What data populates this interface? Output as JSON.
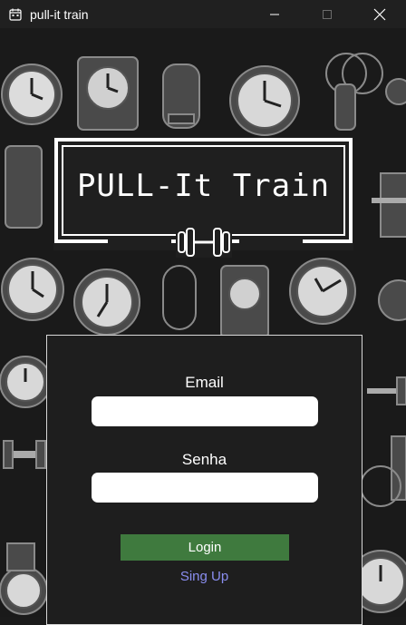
{
  "window": {
    "title": "pull-it train",
    "icons": {
      "app": "calendar-icon",
      "minimize": "minimize-icon",
      "maximize": "maximize-icon",
      "close": "close-icon"
    }
  },
  "logo": {
    "text": "PULL-It Train",
    "icon": "dumbbell-icon"
  },
  "background": {
    "pattern": "clock-and-gym-doodles"
  },
  "login": {
    "email_label": "Email",
    "email_value": "",
    "password_label": "Senha",
    "password_value": "",
    "login_button": "Login",
    "signup_link": "Sing Up"
  },
  "colors": {
    "login_button": "#3f7a3e",
    "signup_link": "#8a8ef0",
    "panel": "#1e1e1e",
    "background": "#1a1a1a"
  }
}
